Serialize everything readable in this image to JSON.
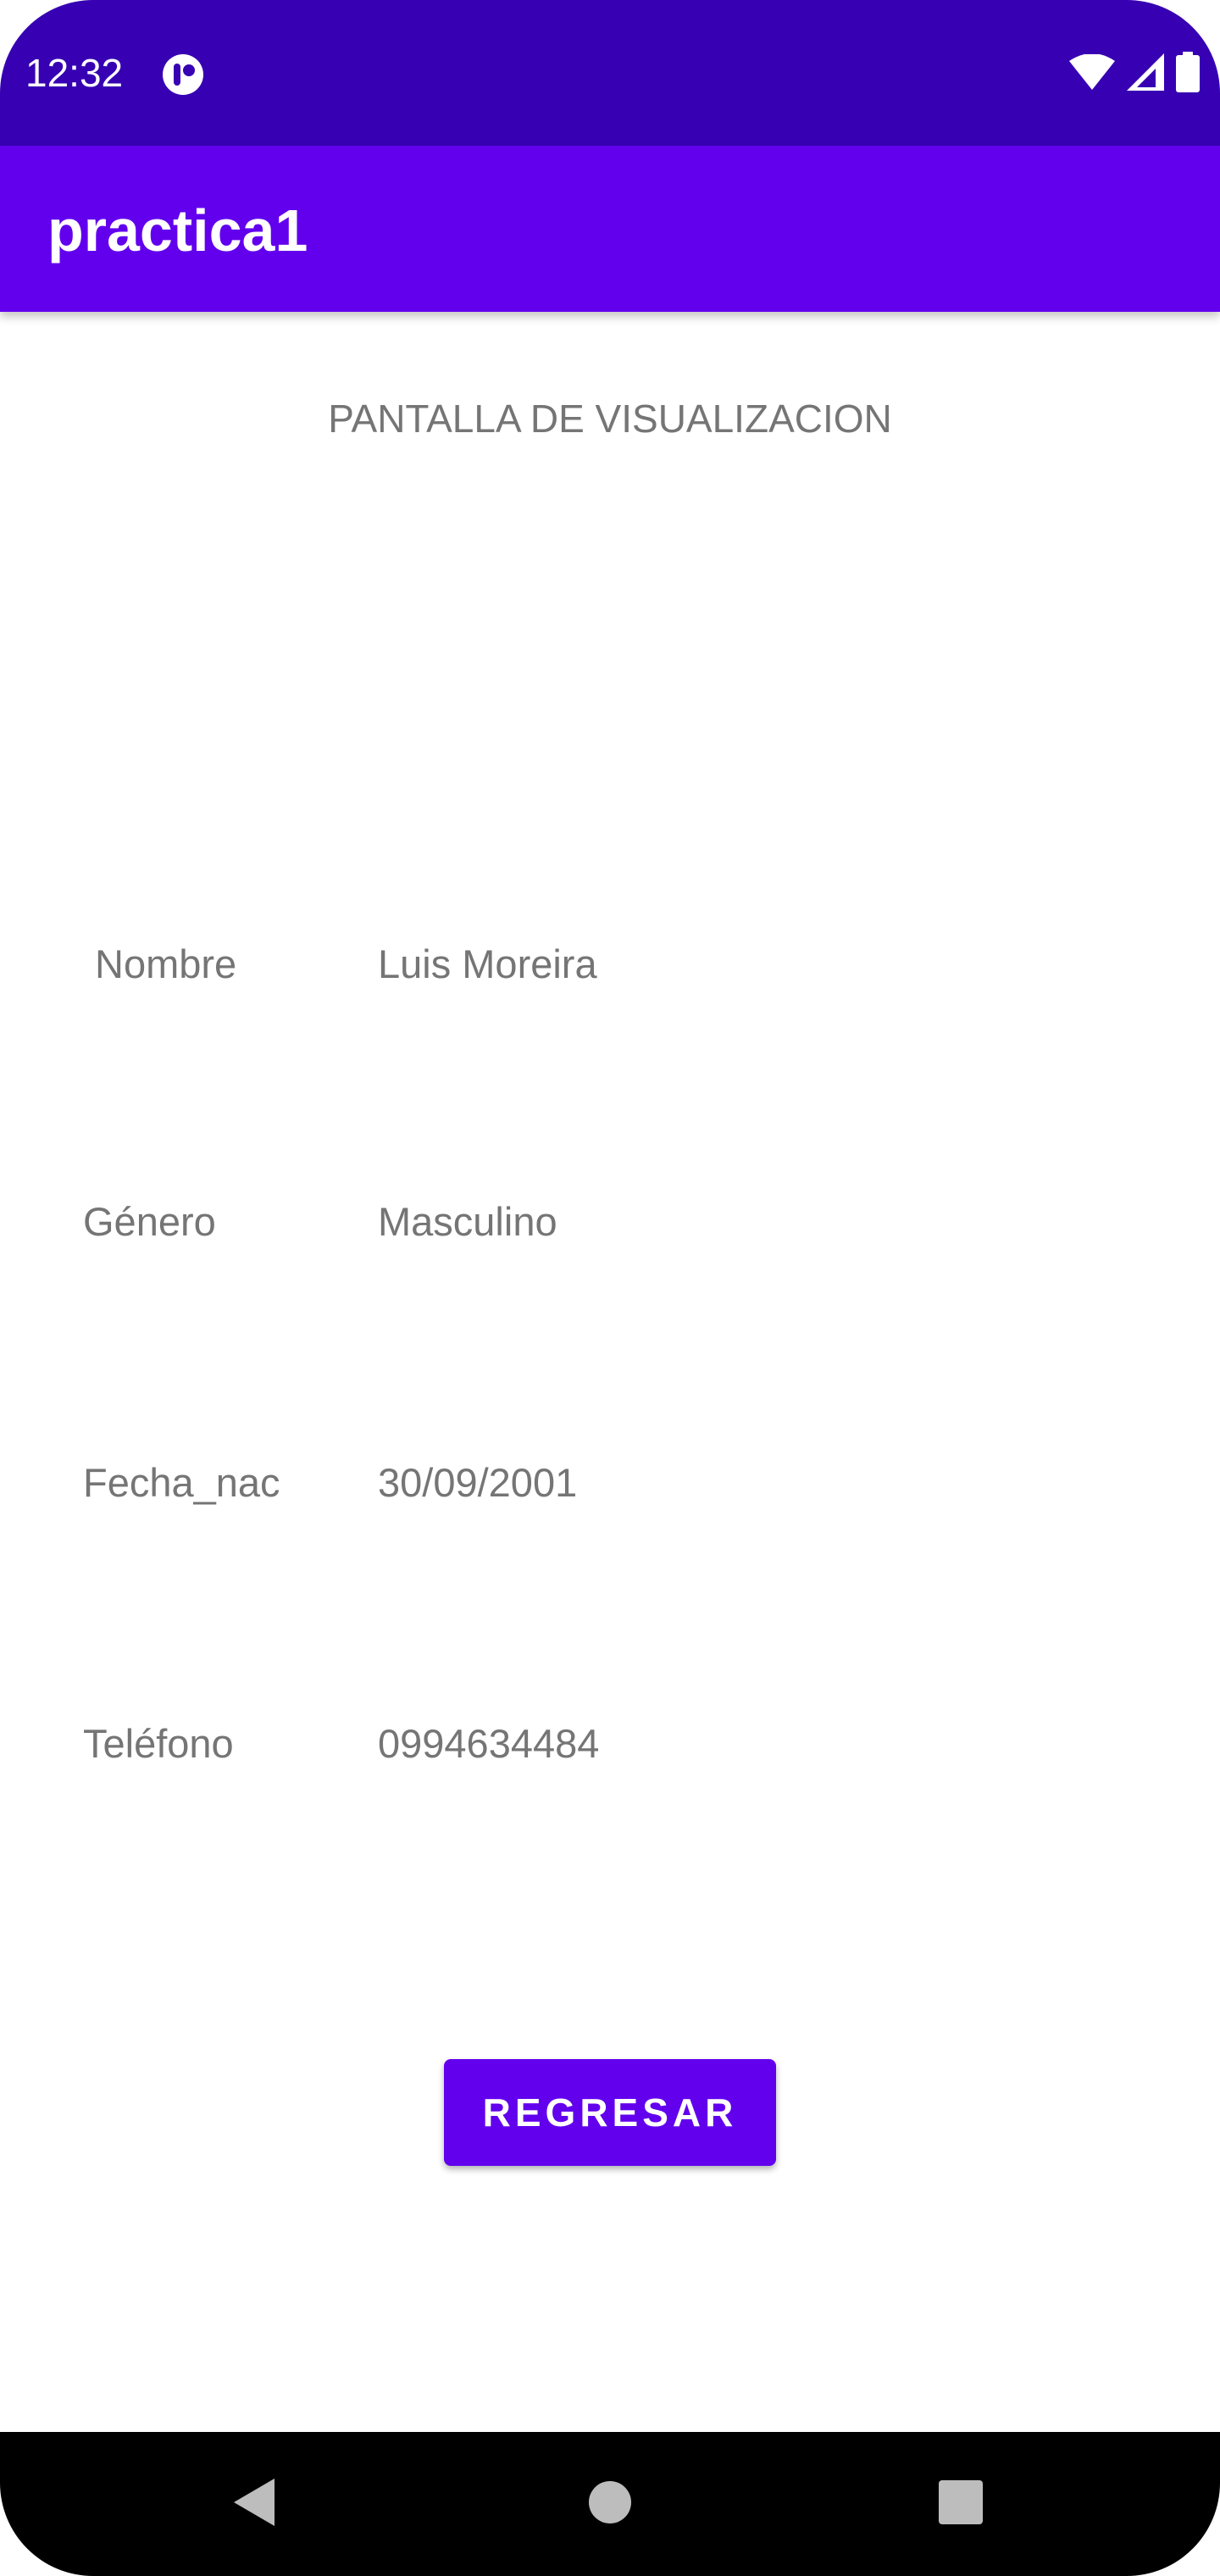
{
  "status_bar": {
    "time": "12:32",
    "icons": [
      "app-notification-icon",
      "wifi-icon",
      "cell-signal-icon",
      "battery-icon"
    ]
  },
  "app_bar": {
    "title": "practica1"
  },
  "screen": {
    "heading": "PANTALLA DE VISUALIZACION",
    "fields": [
      {
        "label": "Nombre",
        "value": "Luis Moreira"
      },
      {
        "label": "Género",
        "value": "Masculino"
      },
      {
        "label": "Fecha_nac",
        "value": "30/09/2001"
      },
      {
        "label": "Teléfono",
        "value": "0994634484"
      }
    ],
    "button_label": "REGRESAR"
  },
  "nav_bar": {
    "icons": [
      "back-icon",
      "home-icon",
      "recents-icon"
    ]
  },
  "colors": {
    "status_bar": "#3700b3",
    "primary": "#6200ee",
    "text_secondary": "#757575",
    "nav_bar": "#000000"
  }
}
